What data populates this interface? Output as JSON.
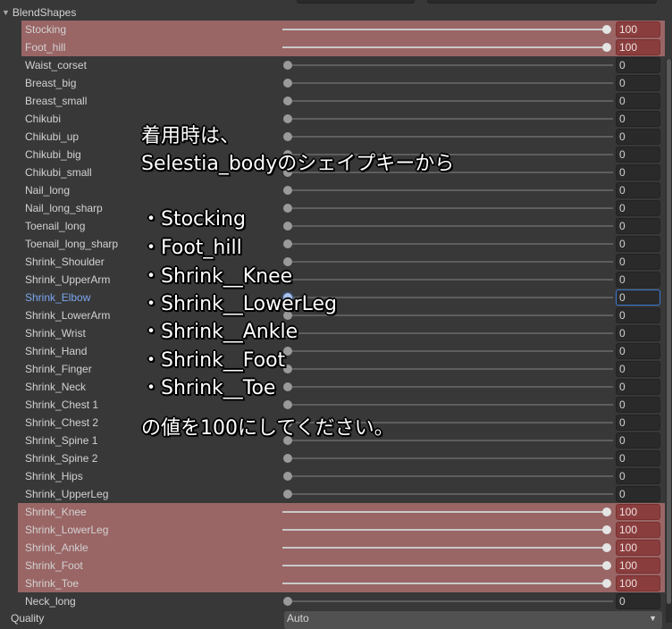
{
  "section": {
    "title": "BlendShapes"
  },
  "blendshapes": [
    {
      "name": "Stocking",
      "value": 100,
      "highlighted": true
    },
    {
      "name": "Foot_hill",
      "value": 100,
      "highlighted": true
    },
    {
      "name": "Waist_corset",
      "value": 0
    },
    {
      "name": "Breast_big",
      "value": 0
    },
    {
      "name": "Breast_small",
      "value": 0
    },
    {
      "name": "Chikubi",
      "value": 0
    },
    {
      "name": "Chikubi_up",
      "value": 0
    },
    {
      "name": "Chikubi_big",
      "value": 0
    },
    {
      "name": "Chikubi_small",
      "value": 0
    },
    {
      "name": "Nail_long",
      "value": 0
    },
    {
      "name": "Nail_long_sharp",
      "value": 0
    },
    {
      "name": "Toenail_long",
      "value": 0
    },
    {
      "name": "Toenail_long_sharp",
      "value": 0
    },
    {
      "name": "Shrink_Shoulder",
      "value": 0
    },
    {
      "name": "Shrink_UpperArm",
      "value": 0
    },
    {
      "name": "Shrink_Elbow",
      "value": 0,
      "selected": true
    },
    {
      "name": "Shrink_LowerArm",
      "value": 0
    },
    {
      "name": "Shrink_Wrist",
      "value": 0
    },
    {
      "name": "Shrink_Hand",
      "value": 0
    },
    {
      "name": "Shrink_Finger",
      "value": 0
    },
    {
      "name": "Shrink_Neck",
      "value": 0
    },
    {
      "name": "Shrink_Chest 1",
      "value": 0
    },
    {
      "name": "Shrink_Chest 2",
      "value": 0
    },
    {
      "name": "Shrink_Spine 1",
      "value": 0
    },
    {
      "name": "Shrink_Spine 2",
      "value": 0
    },
    {
      "name": "Shrink_Hips",
      "value": 0
    },
    {
      "name": "Shrink_UpperLeg",
      "value": 0
    },
    {
      "name": "Shrink_Knee",
      "value": 100,
      "highlighted": true
    },
    {
      "name": "Shrink_LowerLeg",
      "value": 100,
      "highlighted": true
    },
    {
      "name": "Shrink_Ankle",
      "value": 100,
      "highlighted": true
    },
    {
      "name": "Shrink_Foot",
      "value": 100,
      "highlighted": true
    },
    {
      "name": "Shrink_Toe",
      "value": 100,
      "highlighted": true
    },
    {
      "name": "Neck_long",
      "value": 0
    }
  ],
  "quality": {
    "label": "Quality",
    "value": "Auto"
  },
  "annotation": {
    "lines": [
      "着用時は、",
      "Selestia_bodyのシェイプキーから",
      "・Stocking",
      "・Foot_hill",
      "・Shrink__Knee",
      "・Shrink__LowerLeg",
      "・Shrink__Ankle",
      "・Shrink__Foot",
      "・Shrink__Toe",
      "の値を100にしてください。"
    ]
  },
  "colors": {
    "highlight": "#9a6565",
    "selected": "#7aa6ef"
  }
}
